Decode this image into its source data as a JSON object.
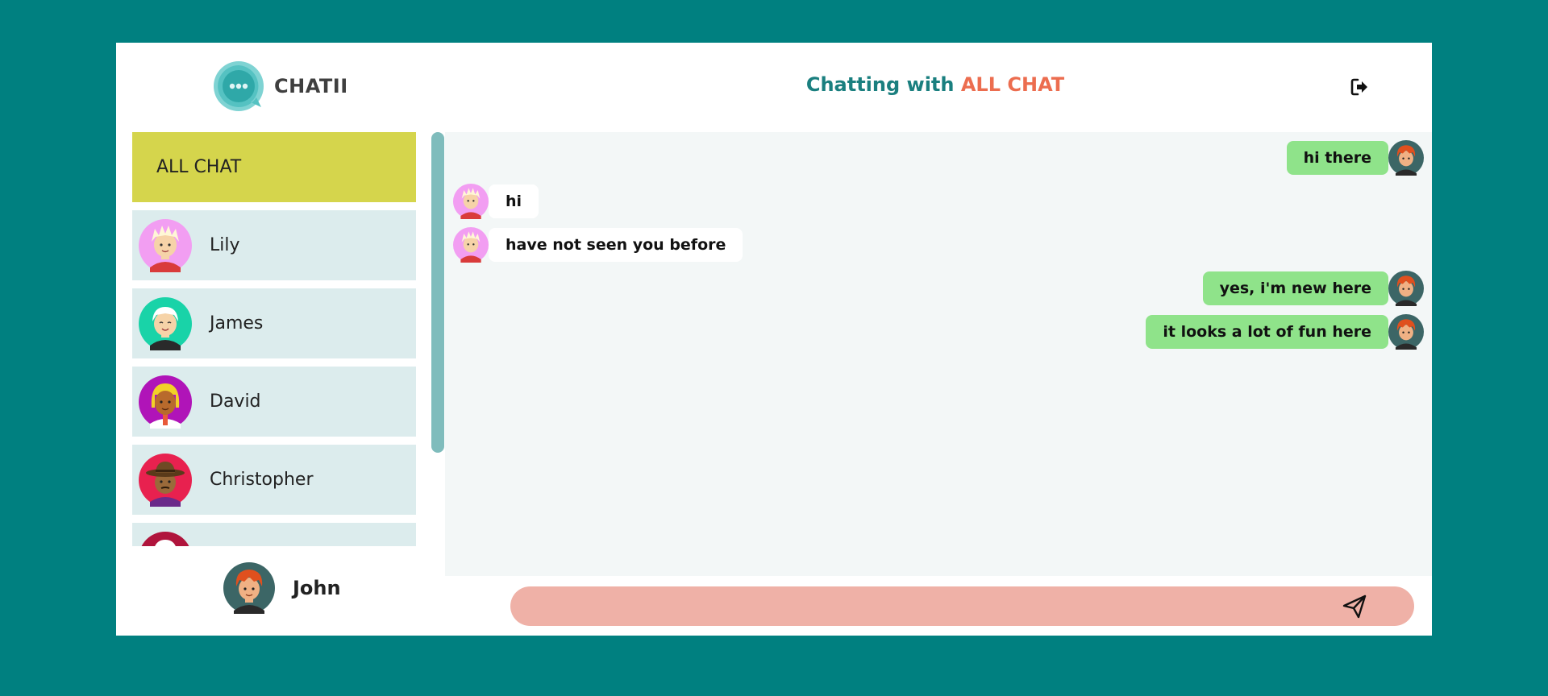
{
  "app": {
    "name": "CHATII"
  },
  "header": {
    "prefix": "Chatting with",
    "room": "ALL CHAT",
    "logout_icon": "logout-icon"
  },
  "sidebar": {
    "items": [
      {
        "label": "ALL CHAT",
        "active": true
      },
      {
        "label": "Lily",
        "avatar": "avatar-pink"
      },
      {
        "label": "James",
        "avatar": "avatar-teal"
      },
      {
        "label": "David",
        "avatar": "avatar-purple"
      },
      {
        "label": "Christopher",
        "avatar": "avatar-red"
      }
    ]
  },
  "current_user": {
    "name": "John",
    "avatar": "avatar-redhead"
  },
  "messages": [
    {
      "text": "hi there",
      "mine": true
    },
    {
      "text": "hi",
      "mine": false
    },
    {
      "text": "have not seen you before",
      "mine": false
    },
    {
      "text": "yes, i'm new here",
      "mine": true
    },
    {
      "text": "it looks a lot of fun here",
      "mine": true
    }
  ],
  "composer": {
    "placeholder": "",
    "send_icon": "send-icon"
  },
  "colors": {
    "background": "#008080",
    "active_item": "#d5d54c",
    "contact_item": "#dceced",
    "own_bubble": "#8fe38a",
    "composer": "#efb1a7",
    "accent": "#ec6d4f",
    "title": "#1a7f7f"
  }
}
